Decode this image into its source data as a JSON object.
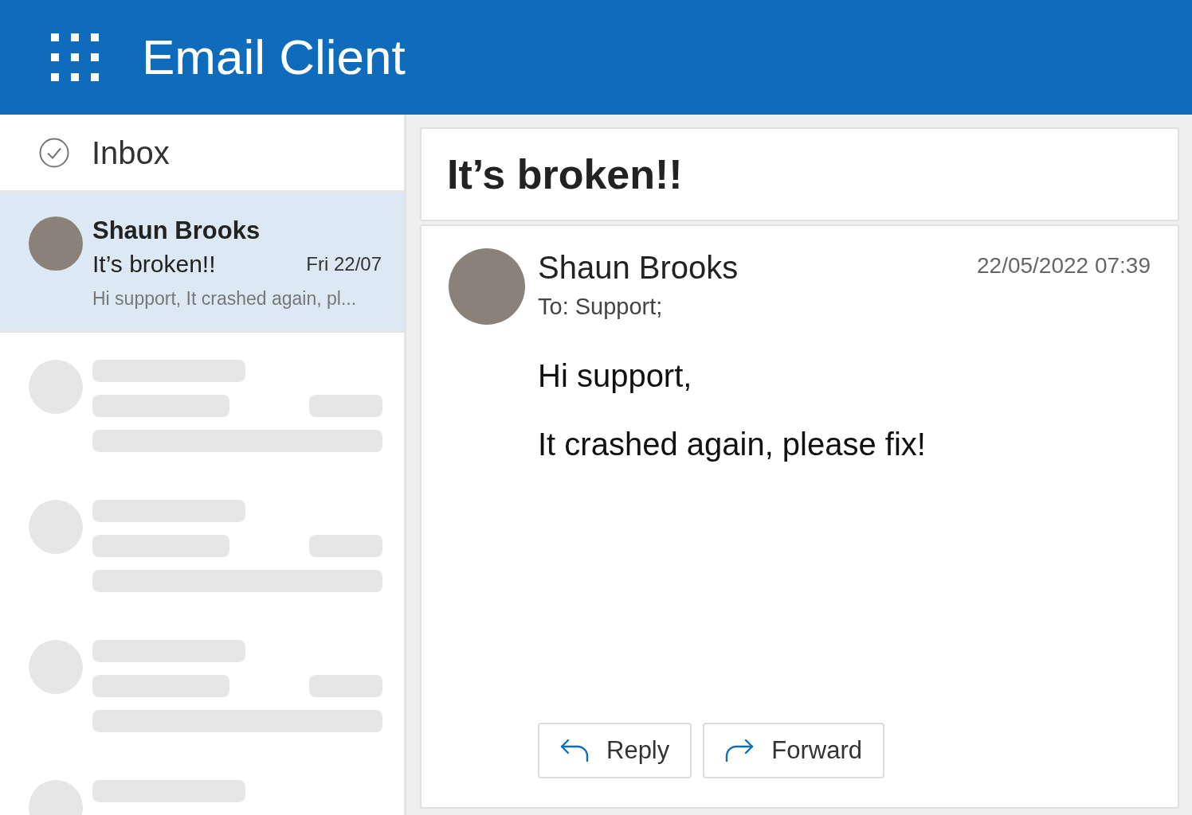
{
  "header": {
    "title": "Email Client"
  },
  "folder": {
    "title": "Inbox"
  },
  "messages": [
    {
      "kind": "email",
      "selected": true,
      "sender": "Shaun Brooks",
      "subject": "It’s broken!!",
      "date": "Fri 22/07",
      "preview": "Hi support, It crashed again, pl..."
    },
    {
      "kind": "skeleton"
    },
    {
      "kind": "skeleton"
    },
    {
      "kind": "skeleton"
    },
    {
      "kind": "skeleton"
    }
  ],
  "reading_pane": {
    "subject": "It’s broken!!",
    "sender": "Shaun Brooks",
    "timestamp": "22/05/2022 07:39",
    "to": "To: Support;",
    "body": [
      "Hi support,",
      "It crashed again, please fix!"
    ],
    "actions": [
      {
        "kind": "reply",
        "label": "Reply"
      },
      {
        "kind": "forward",
        "label": "Forward"
      }
    ]
  }
}
